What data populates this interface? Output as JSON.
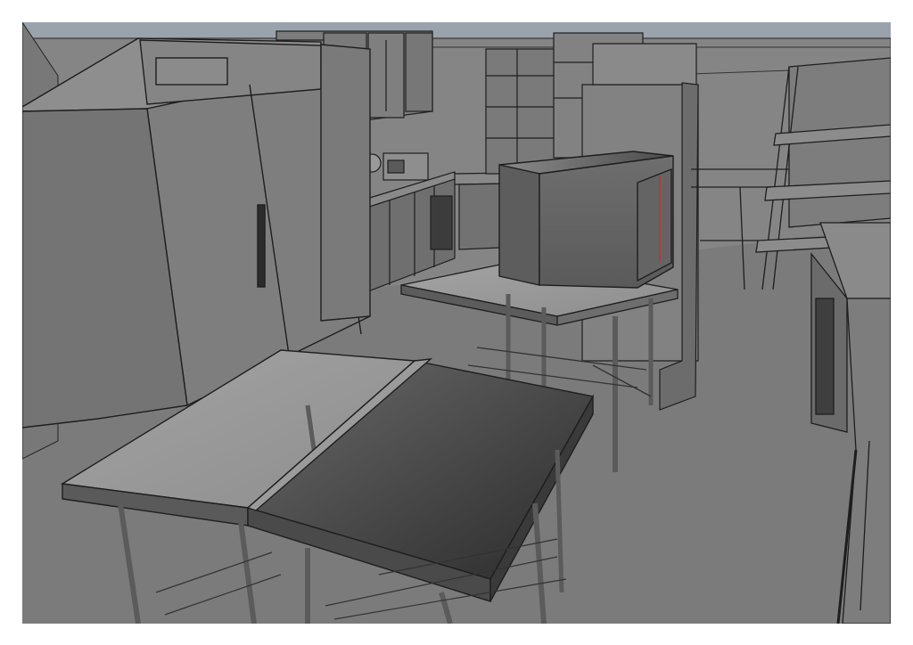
{
  "scene": {
    "subject": "kitchen",
    "render_style": "grayscale",
    "objects": [
      "refrigerator",
      "wall-cabinets",
      "back-counter",
      "toaster",
      "combi-oven",
      "prep-table",
      "oven-stand",
      "shelving-rack",
      "side-counter"
    ]
  },
  "colors": {
    "background": "#ffffff",
    "ceiling": "#9aa3ab",
    "floor": "#7b7b7b",
    "wall": "#858585",
    "metal_dark": "#4a4a4a",
    "accent_red": "#b33a3a"
  }
}
